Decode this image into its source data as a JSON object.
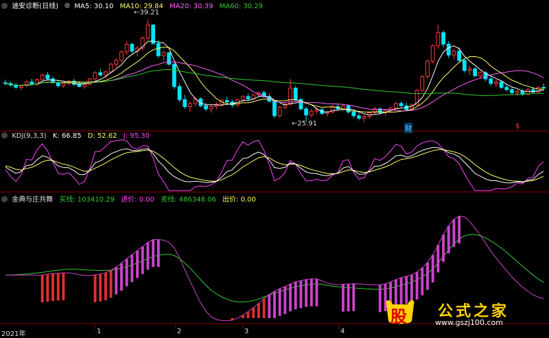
{
  "colors": {
    "bg": "#000000",
    "up": "#ff3b3b",
    "down": "#00e5ff",
    "ma5": "#ffffff",
    "ma10": "#ffff66",
    "ma20": "#ff66ff",
    "ma60": "#33cc33",
    "grid": "#8b0000",
    "k": "#ffffff",
    "d": "#ffff66",
    "j": "#ff44ff",
    "buy_line": "#33cc33",
    "sell_line": "#cc44cc"
  },
  "panel_main": {
    "title": "迪安诊断(日线)",
    "ma": [
      {
        "label": "MA5: 30.10",
        "color": "#ffffff"
      },
      {
        "label": "MA10: 29.84",
        "color": "#ffff66"
      },
      {
        "label": "MA20: 30.39",
        "color": "#ff66ff"
      },
      {
        "label": "MA60: 30.29",
        "color": "#33cc33"
      }
    ],
    "high_label": "39.21",
    "low_label": "25.91",
    "marker_cai": "财",
    "marker_s": "$"
  },
  "panel_kdj": {
    "title": "KDJ(9,3,3)",
    "k": "K: 66.85",
    "d": "D: 52.62",
    "j": "J: 95.30"
  },
  "panel_ind": {
    "title": "金典与庄共舞",
    "buy_line": "买线: 103410.29",
    "buy_price": "进价: 0.00",
    "sell_line": "卖线: 486348.06",
    "sell_price": "出价: 0.00"
  },
  "xaxis": {
    "labels": [
      "2021年",
      "1",
      "2",
      "3",
      "4"
    ]
  },
  "watermark": {
    "logo": "股",
    "name": "公式之家",
    "url": "www.gszj100.com"
  },
  "chart_data": {
    "type": "candlestick",
    "series": [
      {
        "name": "MA5",
        "last": 30.1
      },
      {
        "name": "MA10",
        "last": 29.84
      },
      {
        "name": "MA20",
        "last": 30.39
      },
      {
        "name": "MA60",
        "last": 30.29
      }
    ],
    "annotations": [
      {
        "text": "39.21",
        "kind": "high"
      },
      {
        "text": "25.91",
        "kind": "low"
      }
    ],
    "ohlc": [
      [
        31.0,
        31.4,
        30.6,
        30.9
      ],
      [
        30.9,
        31.2,
        30.5,
        30.7
      ],
      [
        30.7,
        31.0,
        30.2,
        30.4
      ],
      [
        30.4,
        30.8,
        30.0,
        30.6
      ],
      [
        30.6,
        31.3,
        30.5,
        31.1
      ],
      [
        31.1,
        31.5,
        30.7,
        30.8
      ],
      [
        30.8,
        31.6,
        30.6,
        31.4
      ],
      [
        31.4,
        32.2,
        31.2,
        32.0
      ],
      [
        32.0,
        32.4,
        31.3,
        31.5
      ],
      [
        31.5,
        31.8,
        30.9,
        31.0
      ],
      [
        31.0,
        31.3,
        30.4,
        30.6
      ],
      [
        30.6,
        31.1,
        30.3,
        30.9
      ],
      [
        30.9,
        31.4,
        30.7,
        31.2
      ],
      [
        31.2,
        31.5,
        30.6,
        30.8
      ],
      [
        30.8,
        31.2,
        30.4,
        30.5
      ],
      [
        30.5,
        31.0,
        30.2,
        30.8
      ],
      [
        30.8,
        31.6,
        30.7,
        31.5
      ],
      [
        31.5,
        32.5,
        31.3,
        32.3
      ],
      [
        32.3,
        32.8,
        31.8,
        32.0
      ],
      [
        32.0,
        32.6,
        31.6,
        32.4
      ],
      [
        32.4,
        33.6,
        32.2,
        33.4
      ],
      [
        33.4,
        34.2,
        33.0,
        33.9
      ],
      [
        33.9,
        35.2,
        33.6,
        35.0
      ],
      [
        35.0,
        36.4,
        34.6,
        36.0
      ],
      [
        36.0,
        36.2,
        34.8,
        35.1
      ],
      [
        35.1,
        35.8,
        34.4,
        35.5
      ],
      [
        35.5,
        37.0,
        35.2,
        36.8
      ],
      [
        36.8,
        39.21,
        36.5,
        38.5
      ],
      [
        38.5,
        38.6,
        35.9,
        36.1
      ],
      [
        36.1,
        36.5,
        34.2,
        34.5
      ],
      [
        34.5,
        35.2,
        33.8,
        34.9
      ],
      [
        34.9,
        35.0,
        33.2,
        33.4
      ],
      [
        33.4,
        33.6,
        30.2,
        30.5
      ],
      [
        30.5,
        30.9,
        28.5,
        28.8
      ],
      [
        28.8,
        29.4,
        27.6,
        27.9
      ],
      [
        27.9,
        28.6,
        27.2,
        28.3
      ],
      [
        28.3,
        29.2,
        27.9,
        28.9
      ],
      [
        28.9,
        29.1,
        27.8,
        28.0
      ],
      [
        28.0,
        28.4,
        27.3,
        27.6
      ],
      [
        27.6,
        28.2,
        27.1,
        27.9
      ],
      [
        27.9,
        28.5,
        27.5,
        28.2
      ],
      [
        28.2,
        28.9,
        27.9,
        28.7
      ],
      [
        28.7,
        29.2,
        28.3,
        28.5
      ],
      [
        28.5,
        28.8,
        27.8,
        28.1
      ],
      [
        28.1,
        28.9,
        27.9,
        28.8
      ],
      [
        28.8,
        29.4,
        28.5,
        29.2
      ],
      [
        29.2,
        29.6,
        28.6,
        28.9
      ],
      [
        28.9,
        29.5,
        28.7,
        29.4
      ],
      [
        29.4,
        29.9,
        29.1,
        29.7
      ],
      [
        29.7,
        30.0,
        29.0,
        29.2
      ],
      [
        29.2,
        29.6,
        28.4,
        28.6
      ],
      [
        28.6,
        28.8,
        26.4,
        26.7
      ],
      [
        26.7,
        28.0,
        26.5,
        27.8
      ],
      [
        27.8,
        28.4,
        27.5,
        28.2
      ],
      [
        28.2,
        31.5,
        28.0,
        30.3
      ],
      [
        30.3,
        30.6,
        28.6,
        28.8
      ],
      [
        28.8,
        29.0,
        27.4,
        27.6
      ],
      [
        27.6,
        27.9,
        25.91,
        26.8
      ],
      [
        26.8,
        27.6,
        26.5,
        27.3
      ],
      [
        27.3,
        27.8,
        26.9,
        27.5
      ],
      [
        27.5,
        27.7,
        26.8,
        27.0
      ],
      [
        27.0,
        27.4,
        26.6,
        27.2
      ],
      [
        27.2,
        28.1,
        27.0,
        27.9
      ],
      [
        27.9,
        28.3,
        27.4,
        27.6
      ],
      [
        27.6,
        28.2,
        27.3,
        28.0
      ],
      [
        28.0,
        28.2,
        27.0,
        27.2
      ],
      [
        27.2,
        27.5,
        26.4,
        26.7
      ],
      [
        26.7,
        27.0,
        26.1,
        26.4
      ],
      [
        26.4,
        26.9,
        25.9,
        26.6
      ],
      [
        26.6,
        27.3,
        26.3,
        27.1
      ],
      [
        27.1,
        27.9,
        26.8,
        27.6
      ],
      [
        27.6,
        27.8,
        26.9,
        27.1
      ],
      [
        27.1,
        27.6,
        26.7,
        27.4
      ],
      [
        27.4,
        27.9,
        27.1,
        27.7
      ],
      [
        27.7,
        28.5,
        27.5,
        28.3
      ],
      [
        28.3,
        28.6,
        27.8,
        28.0
      ],
      [
        28.0,
        28.4,
        27.3,
        27.5
      ],
      [
        27.5,
        28.3,
        27.3,
        28.1
      ],
      [
        28.1,
        30.2,
        28.0,
        30.0
      ],
      [
        30.0,
        32.0,
        29.8,
        31.8
      ],
      [
        31.8,
        34.0,
        31.5,
        33.8
      ],
      [
        33.8,
        36.0,
        33.5,
        35.8
      ],
      [
        35.8,
        38.5,
        35.4,
        37.5
      ],
      [
        37.5,
        37.8,
        35.6,
        36.0
      ],
      [
        36.0,
        36.4,
        34.2,
        34.6
      ],
      [
        34.6,
        35.4,
        34.0,
        35.1
      ],
      [
        35.1,
        35.6,
        33.6,
        33.9
      ],
      [
        33.9,
        34.1,
        32.3,
        32.6
      ],
      [
        32.6,
        33.2,
        32.0,
        32.8
      ],
      [
        32.8,
        33.0,
        31.7,
        31.9
      ],
      [
        31.9,
        32.6,
        31.5,
        32.3
      ],
      [
        32.3,
        32.5,
        31.2,
        31.5
      ],
      [
        31.5,
        31.8,
        30.6,
        30.9
      ],
      [
        30.9,
        31.4,
        30.4,
        31.1
      ],
      [
        31.1,
        31.3,
        30.2,
        30.4
      ],
      [
        30.4,
        30.8,
        29.9,
        30.1
      ],
      [
        30.1,
        30.4,
        29.4,
        29.7
      ],
      [
        29.7,
        30.1,
        29.3,
        29.9
      ],
      [
        29.9,
        30.2,
        29.3,
        29.5
      ],
      [
        29.5,
        30.3,
        29.4,
        30.1
      ],
      [
        30.1,
        30.5,
        29.6,
        29.8
      ],
      [
        29.8,
        30.6,
        29.7,
        30.4
      ],
      [
        30.4,
        30.9,
        30.1,
        30.3
      ]
    ],
    "kdj_label_values": {
      "K": 66.85,
      "D": 52.62,
      "J": 95.3
    },
    "indicator_label_values": {
      "buy_line": 103410.29,
      "buy_price": 0.0,
      "sell_line": 486348.06,
      "sell_price": 0.0
    }
  }
}
